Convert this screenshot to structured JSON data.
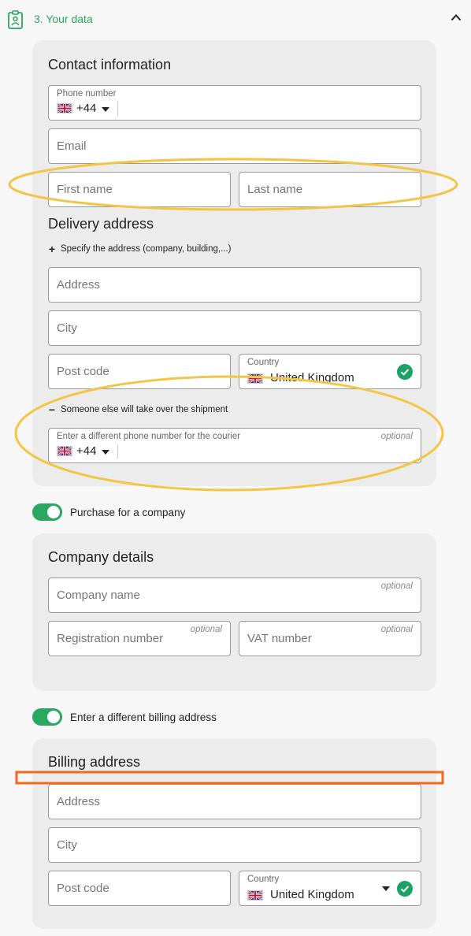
{
  "step": {
    "title": "3. Your data"
  },
  "contact": {
    "title": "Contact information",
    "phone_label": "Phone number",
    "phone_code": "+44",
    "email_placeholder": "Email",
    "first_name_placeholder": "First name",
    "last_name_placeholder": "Last name"
  },
  "delivery": {
    "title": "Delivery address",
    "specify_link": "Specify the address (company, building,...)",
    "address_placeholder": "Address",
    "city_placeholder": "City",
    "postcode_placeholder": "Post code",
    "country_label": "Country",
    "country_value": "United Kingdom",
    "someone_else_link": "Someone else will take over the shipment",
    "courier_phone_label": "Enter a different phone number for the courier",
    "courier_optional": "optional",
    "courier_phone_code": "+44"
  },
  "company_toggle": {
    "label": "Purchase for a company",
    "on": true
  },
  "company": {
    "title": "Company details",
    "name_placeholder": "Company name",
    "name_optional": "optional",
    "reg_placeholder": "Registration number",
    "reg_optional": "optional",
    "vat_placeholder": "VAT number",
    "vat_optional": "optional"
  },
  "billing_toggle": {
    "label": "Enter a different billing address",
    "on": true
  },
  "billing": {
    "title": "Billing address",
    "address_placeholder": "Address",
    "city_placeholder": "City",
    "postcode_placeholder": "Post code",
    "country_label": "Country",
    "country_value": "United Kingdom"
  },
  "colors": {
    "accent_green": "#2aa760",
    "check_green": "#1ea069",
    "annotation_yellow": "#f3c545",
    "annotation_orange": "#f06a1c"
  },
  "icons": [
    "clipboard-user-icon",
    "chevron-up-icon",
    "uk-flag-icon",
    "caret-down-icon",
    "plus-icon",
    "minus-icon",
    "check-circle-icon"
  ]
}
